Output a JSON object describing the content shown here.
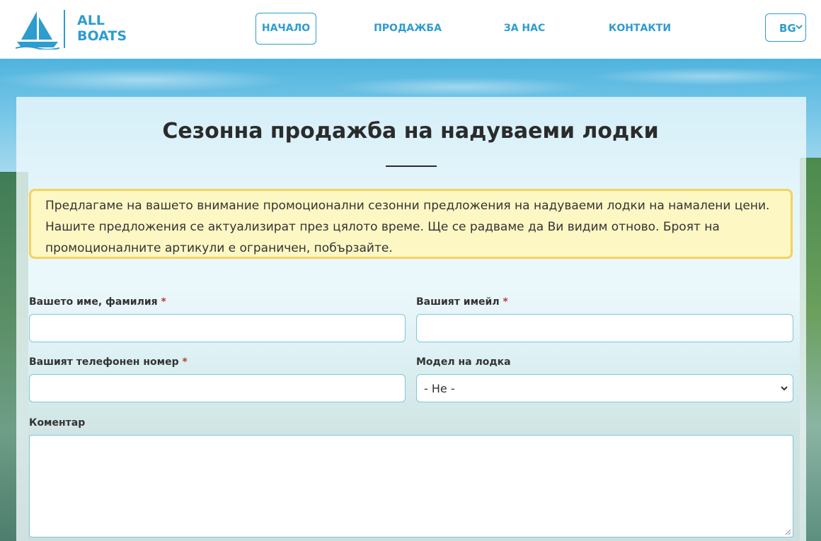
{
  "brand": {
    "line1": "ALL",
    "line2": "BOATS",
    "logo_icon": "sailboat-icon",
    "color": "#2e9ccf"
  },
  "nav": {
    "items": [
      {
        "label": "НАЧАЛО",
        "active": true
      },
      {
        "label": "ПРОДАЖБА",
        "active": false
      },
      {
        "label": "ЗА НАС",
        "active": false
      },
      {
        "label": "КОНТАКТИ",
        "active": false
      }
    ],
    "language": {
      "label": "BG",
      "icon": "chevron-down-icon"
    }
  },
  "page": {
    "title": "Сезонна продажба на надуваеми лодки",
    "notice": {
      "line1": "Предлагаме на вашето внимание промоционални сезонни предложения на надуваеми лодки на намалени цени.",
      "line2": "Нашите предложения се актуализират през цялото време. Ще се радваме да Ви видим отново. Броят на",
      "line3": "промоционалните артикули е ограничен, побързайте."
    }
  },
  "form": {
    "name": {
      "label": "Вашето име, фамилия",
      "required_mark": "*",
      "value": ""
    },
    "email": {
      "label": "Вашият имейл",
      "required_mark": "*",
      "value": ""
    },
    "phone": {
      "label": "Вашият телефонен номер",
      "required_mark": "*",
      "value": ""
    },
    "model": {
      "label": "Модел на лодка",
      "selected": "- Не -"
    },
    "comment": {
      "label": "Коментар",
      "value": ""
    }
  },
  "colors": {
    "accent": "#2e9ccf",
    "notice_bg": "#fdf7c3",
    "notice_border": "#f2d35e",
    "required": "#c0392b"
  }
}
